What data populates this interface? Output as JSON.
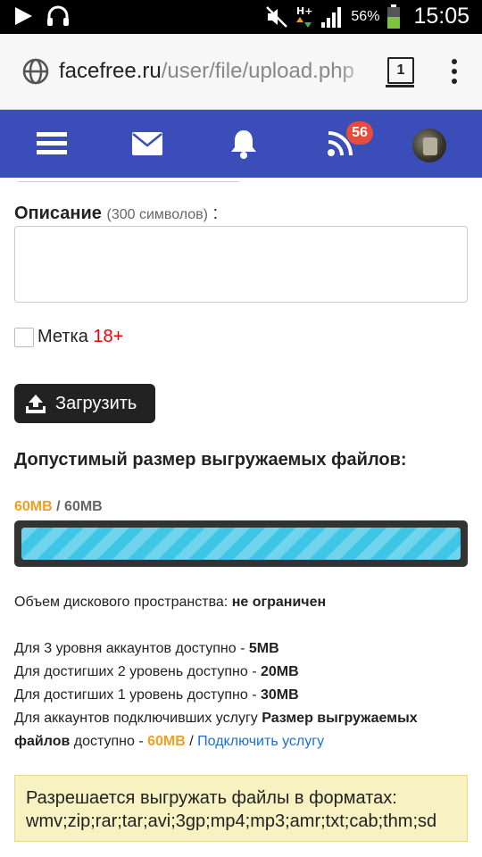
{
  "status_bar": {
    "battery_percent": "56%",
    "time": "15:05",
    "icons": [
      "play-icon",
      "headphones-icon",
      "mute-icon",
      "hplus-data-icon",
      "signal-icon",
      "battery-icon"
    ]
  },
  "browser": {
    "url_host": "facefree.ru",
    "url_path": "/user/file/upload.php",
    "tab_count": "1",
    "icons": [
      "globe-icon",
      "tabs-icon",
      "menu-kebab-icon"
    ]
  },
  "site_nav": {
    "icons": [
      "hamburger-icon",
      "mail-icon",
      "bell-icon",
      "rss-icon",
      "avatar"
    ],
    "rss_badge": "56",
    "colors": {
      "bar": "#3b4db8",
      "badge": "#e84c3d"
    }
  },
  "form": {
    "description_label": "Описание",
    "description_hint": "(300 символов)",
    "description_suffix": ":",
    "description_value": "",
    "adult_label": "Метка",
    "adult_mark": "18+",
    "adult_checked": false,
    "upload_button": "Загрузить"
  },
  "limits": {
    "title": "Допустимый размер выгружаемых файлов:",
    "used": "60MB",
    "separator": "/",
    "total": "60MB",
    "progress_percent": 100,
    "disk_label": "Объем дискового пространства:",
    "disk_value": "не ограничен",
    "level3_text": "Для 3 уровня аккаунтов доступно -",
    "level3_value": "5MB",
    "level2_text": "Для достигших 2 уровень доступно -",
    "level2_value": "20MB",
    "level1_text": "Для достигших 1 уровень доступно -",
    "level1_value": "30MB",
    "service_text": "Для аккаунтов подключивших услугу",
    "service_name_1": "Размер выгружаемых",
    "service_name_2": "файлов",
    "service_text_2": "доступно -",
    "service_value": "60MB",
    "service_sep": "/",
    "service_link": "Подключить услугу"
  },
  "formats": {
    "heading": "Разрешается выгружать файлы в форматах:",
    "list": "wmv;zip;rar;tar;avi;3gp;mp4;mp3;amr;txt;cab;thm;sd"
  }
}
